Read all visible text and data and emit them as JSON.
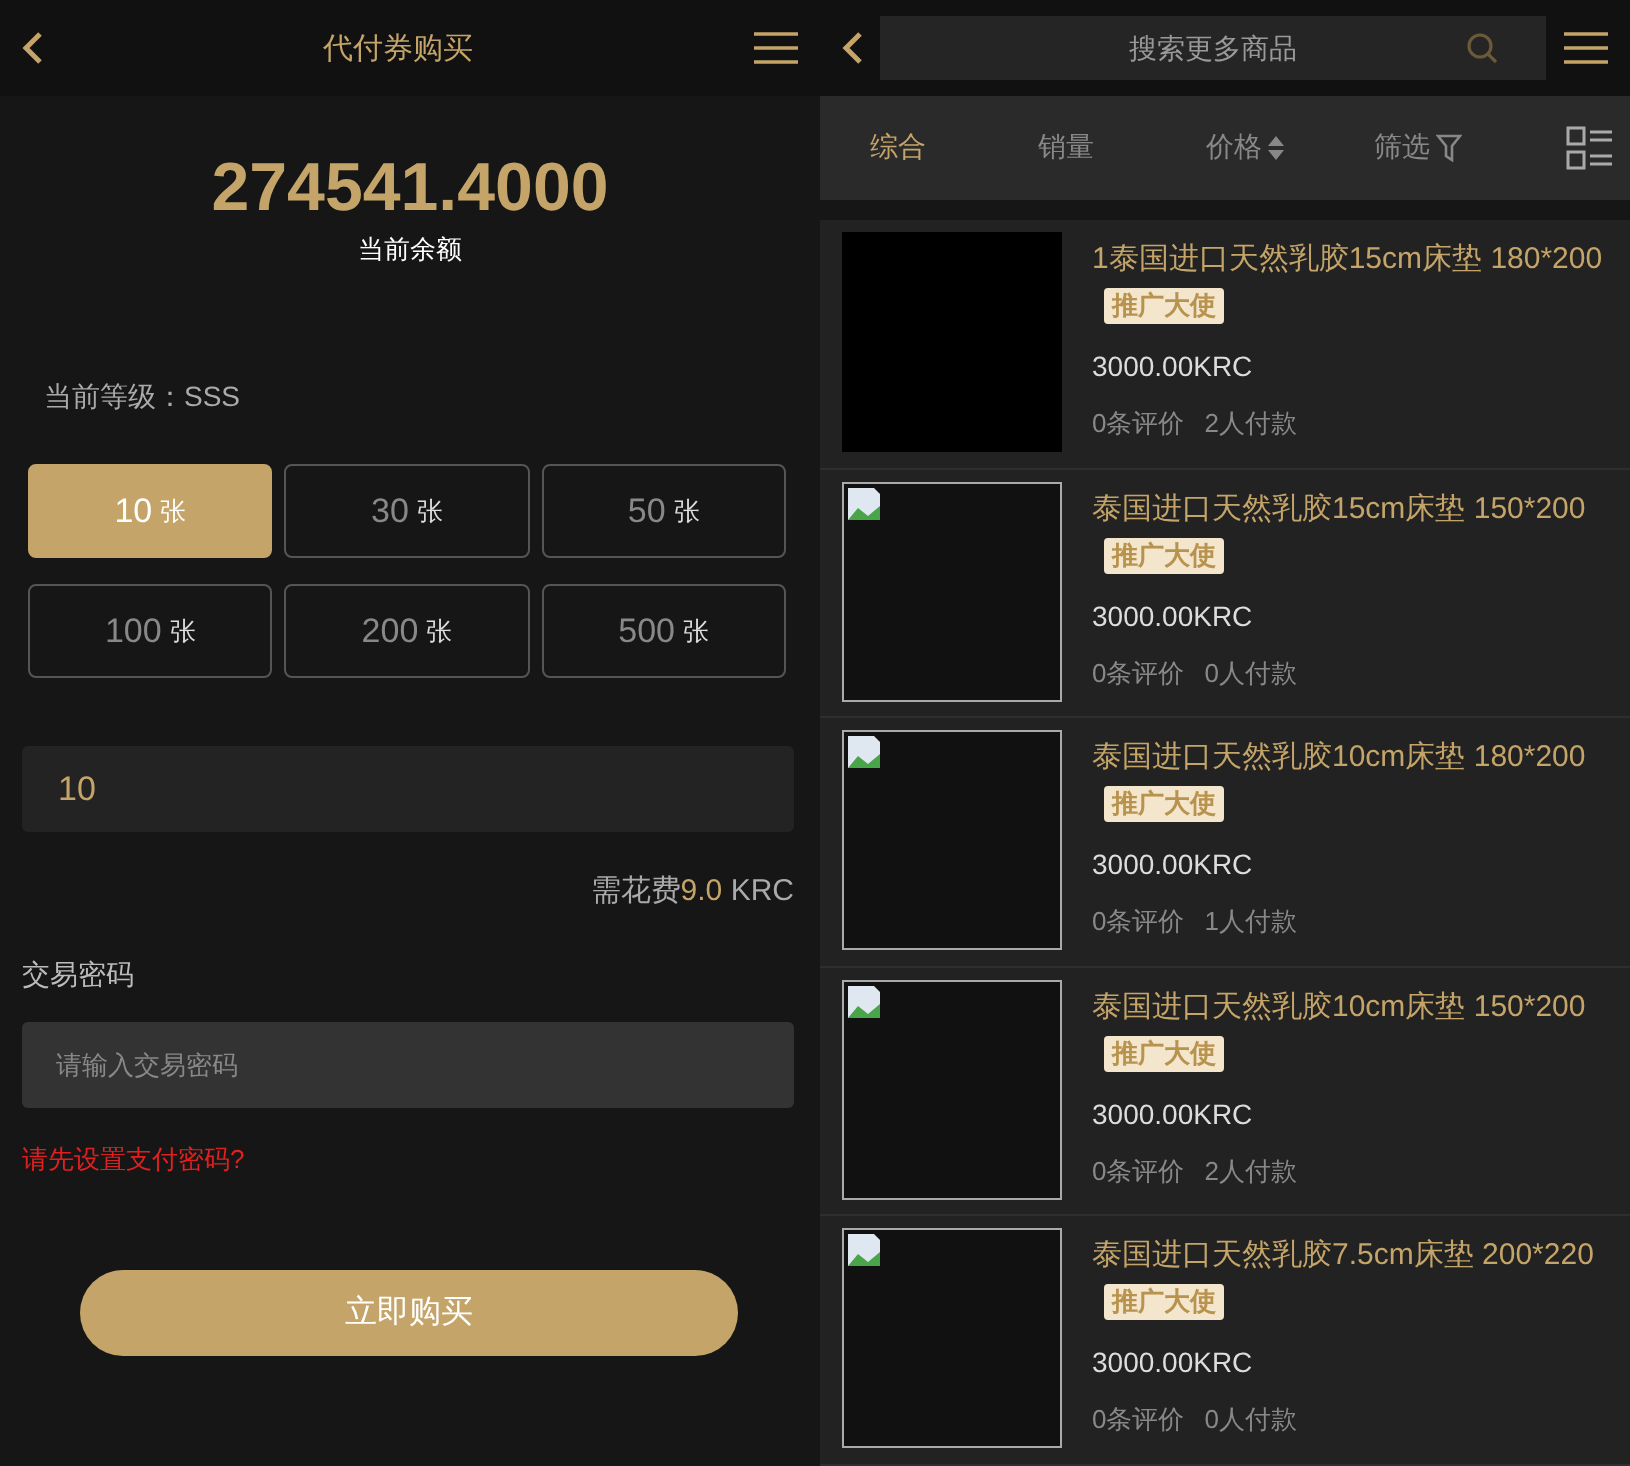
{
  "left": {
    "header": {
      "title": "代付券购买"
    },
    "balance": {
      "amount": "274541.4000",
      "label": "当前余额"
    },
    "level_text": "当前等级：SSS",
    "options": [
      {
        "count": "10",
        "unit": "张",
        "selected": true
      },
      {
        "count": "30",
        "unit": "张",
        "selected": false
      },
      {
        "count": "50",
        "unit": "张",
        "selected": false
      },
      {
        "count": "100",
        "unit": "张",
        "selected": false
      },
      {
        "count": "200",
        "unit": "张",
        "selected": false
      },
      {
        "count": "500",
        "unit": "张",
        "selected": false
      }
    ],
    "quantity": {
      "value": "10"
    },
    "fee": {
      "prefix": "需花费",
      "amount": "9.0",
      "unit": " KRC"
    },
    "password": {
      "label": "交易密码",
      "placeholder": "请输入交易密码"
    },
    "warning_link": "请先设置支付密码?",
    "submit": "立即购买"
  },
  "right": {
    "search": {
      "placeholder": "搜索更多商品"
    },
    "sort_tabs": [
      {
        "label": "综合",
        "kind": "plain",
        "selected": true
      },
      {
        "label": "销量",
        "kind": "plain",
        "selected": false
      },
      {
        "label": "价格",
        "kind": "price",
        "selected": false
      },
      {
        "label": "筛选",
        "kind": "filter",
        "selected": false
      }
    ],
    "products": [
      {
        "kind": "blank",
        "title": "1泰国进口天然乳胶15cm床垫 180*200",
        "tag": "推广大使",
        "price": "3000.00KRC",
        "reviews": "0条评价",
        "payers": "2人付款"
      },
      {
        "kind": "broken",
        "title": "泰国进口天然乳胶15cm床垫 150*200",
        "tag": "推广大使",
        "price": "3000.00KRC",
        "reviews": "0条评价",
        "payers": "0人付款"
      },
      {
        "kind": "broken",
        "title": "泰国进口天然乳胶10cm床垫 180*200",
        "tag": "推广大使",
        "price": "3000.00KRC",
        "reviews": "0条评价",
        "payers": "1人付款"
      },
      {
        "kind": "broken",
        "title": "泰国进口天然乳胶10cm床垫 150*200",
        "tag": "推广大使",
        "price": "3000.00KRC",
        "reviews": "0条评价",
        "payers": "2人付款"
      },
      {
        "kind": "broken",
        "title": "泰国进口天然乳胶7.5cm床垫 200*220",
        "tag": "推广大使",
        "price": "3000.00KRC",
        "reviews": "0条评价",
        "payers": "0人付款"
      }
    ]
  }
}
